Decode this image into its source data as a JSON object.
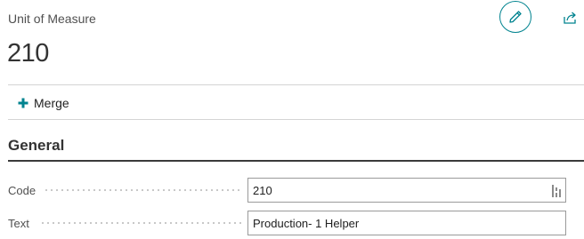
{
  "header": {
    "caption": "Unit of Measure",
    "record_title": "210"
  },
  "actions": {
    "merge_label": "Merge"
  },
  "section": {
    "title": "General"
  },
  "fields": [
    {
      "label": "Code",
      "value": "210"
    },
    {
      "label": "Text",
      "value": "Production- 1 Helper"
    }
  ],
  "colors": {
    "accent": "#00838f",
    "section_rule": "#3a3a3a"
  },
  "icons": {
    "edit": "pencil-icon",
    "share": "share-icon",
    "merge": "plus-icon",
    "lookup": "lookup-icon"
  }
}
